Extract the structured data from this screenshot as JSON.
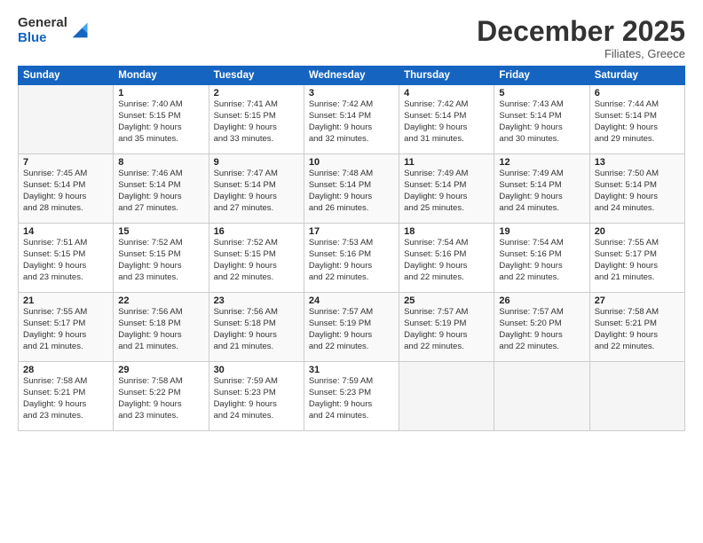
{
  "logo": {
    "general": "General",
    "blue": "Blue"
  },
  "header": {
    "month": "December 2025",
    "location": "Filiates, Greece"
  },
  "weekdays": [
    "Sunday",
    "Monday",
    "Tuesday",
    "Wednesday",
    "Thursday",
    "Friday",
    "Saturday"
  ],
  "weeks": [
    [
      {
        "day": "",
        "sunrise": "",
        "sunset": "",
        "daylight": ""
      },
      {
        "day": "1",
        "sunrise": "Sunrise: 7:40 AM",
        "sunset": "Sunset: 5:15 PM",
        "daylight": "Daylight: 9 hours and 35 minutes."
      },
      {
        "day": "2",
        "sunrise": "Sunrise: 7:41 AM",
        "sunset": "Sunset: 5:15 PM",
        "daylight": "Daylight: 9 hours and 33 minutes."
      },
      {
        "day": "3",
        "sunrise": "Sunrise: 7:42 AM",
        "sunset": "Sunset: 5:14 PM",
        "daylight": "Daylight: 9 hours and 32 minutes."
      },
      {
        "day": "4",
        "sunrise": "Sunrise: 7:42 AM",
        "sunset": "Sunset: 5:14 PM",
        "daylight": "Daylight: 9 hours and 31 minutes."
      },
      {
        "day": "5",
        "sunrise": "Sunrise: 7:43 AM",
        "sunset": "Sunset: 5:14 PM",
        "daylight": "Daylight: 9 hours and 30 minutes."
      },
      {
        "day": "6",
        "sunrise": "Sunrise: 7:44 AM",
        "sunset": "Sunset: 5:14 PM",
        "daylight": "Daylight: 9 hours and 29 minutes."
      }
    ],
    [
      {
        "day": "7",
        "sunrise": "Sunrise: 7:45 AM",
        "sunset": "Sunset: 5:14 PM",
        "daylight": "Daylight: 9 hours and 28 minutes."
      },
      {
        "day": "8",
        "sunrise": "Sunrise: 7:46 AM",
        "sunset": "Sunset: 5:14 PM",
        "daylight": "Daylight: 9 hours and 27 minutes."
      },
      {
        "day": "9",
        "sunrise": "Sunrise: 7:47 AM",
        "sunset": "Sunset: 5:14 PM",
        "daylight": "Daylight: 9 hours and 27 minutes."
      },
      {
        "day": "10",
        "sunrise": "Sunrise: 7:48 AM",
        "sunset": "Sunset: 5:14 PM",
        "daylight": "Daylight: 9 hours and 26 minutes."
      },
      {
        "day": "11",
        "sunrise": "Sunrise: 7:49 AM",
        "sunset": "Sunset: 5:14 PM",
        "daylight": "Daylight: 9 hours and 25 minutes."
      },
      {
        "day": "12",
        "sunrise": "Sunrise: 7:49 AM",
        "sunset": "Sunset: 5:14 PM",
        "daylight": "Daylight: 9 hours and 24 minutes."
      },
      {
        "day": "13",
        "sunrise": "Sunrise: 7:50 AM",
        "sunset": "Sunset: 5:14 PM",
        "daylight": "Daylight: 9 hours and 24 minutes."
      }
    ],
    [
      {
        "day": "14",
        "sunrise": "Sunrise: 7:51 AM",
        "sunset": "Sunset: 5:15 PM",
        "daylight": "Daylight: 9 hours and 23 minutes."
      },
      {
        "day": "15",
        "sunrise": "Sunrise: 7:52 AM",
        "sunset": "Sunset: 5:15 PM",
        "daylight": "Daylight: 9 hours and 23 minutes."
      },
      {
        "day": "16",
        "sunrise": "Sunrise: 7:52 AM",
        "sunset": "Sunset: 5:15 PM",
        "daylight": "Daylight: 9 hours and 22 minutes."
      },
      {
        "day": "17",
        "sunrise": "Sunrise: 7:53 AM",
        "sunset": "Sunset: 5:16 PM",
        "daylight": "Daylight: 9 hours and 22 minutes."
      },
      {
        "day": "18",
        "sunrise": "Sunrise: 7:54 AM",
        "sunset": "Sunset: 5:16 PM",
        "daylight": "Daylight: 9 hours and 22 minutes."
      },
      {
        "day": "19",
        "sunrise": "Sunrise: 7:54 AM",
        "sunset": "Sunset: 5:16 PM",
        "daylight": "Daylight: 9 hours and 22 minutes."
      },
      {
        "day": "20",
        "sunrise": "Sunrise: 7:55 AM",
        "sunset": "Sunset: 5:17 PM",
        "daylight": "Daylight: 9 hours and 21 minutes."
      }
    ],
    [
      {
        "day": "21",
        "sunrise": "Sunrise: 7:55 AM",
        "sunset": "Sunset: 5:17 PM",
        "daylight": "Daylight: 9 hours and 21 minutes."
      },
      {
        "day": "22",
        "sunrise": "Sunrise: 7:56 AM",
        "sunset": "Sunset: 5:18 PM",
        "daylight": "Daylight: 9 hours and 21 minutes."
      },
      {
        "day": "23",
        "sunrise": "Sunrise: 7:56 AM",
        "sunset": "Sunset: 5:18 PM",
        "daylight": "Daylight: 9 hours and 21 minutes."
      },
      {
        "day": "24",
        "sunrise": "Sunrise: 7:57 AM",
        "sunset": "Sunset: 5:19 PM",
        "daylight": "Daylight: 9 hours and 22 minutes."
      },
      {
        "day": "25",
        "sunrise": "Sunrise: 7:57 AM",
        "sunset": "Sunset: 5:19 PM",
        "daylight": "Daylight: 9 hours and 22 minutes."
      },
      {
        "day": "26",
        "sunrise": "Sunrise: 7:57 AM",
        "sunset": "Sunset: 5:20 PM",
        "daylight": "Daylight: 9 hours and 22 minutes."
      },
      {
        "day": "27",
        "sunrise": "Sunrise: 7:58 AM",
        "sunset": "Sunset: 5:21 PM",
        "daylight": "Daylight: 9 hours and 22 minutes."
      }
    ],
    [
      {
        "day": "28",
        "sunrise": "Sunrise: 7:58 AM",
        "sunset": "Sunset: 5:21 PM",
        "daylight": "Daylight: 9 hours and 23 minutes."
      },
      {
        "day": "29",
        "sunrise": "Sunrise: 7:58 AM",
        "sunset": "Sunset: 5:22 PM",
        "daylight": "Daylight: 9 hours and 23 minutes."
      },
      {
        "day": "30",
        "sunrise": "Sunrise: 7:59 AM",
        "sunset": "Sunset: 5:23 PM",
        "daylight": "Daylight: 9 hours and 24 minutes."
      },
      {
        "day": "31",
        "sunrise": "Sunrise: 7:59 AM",
        "sunset": "Sunset: 5:23 PM",
        "daylight": "Daylight: 9 hours and 24 minutes."
      },
      {
        "day": "",
        "sunrise": "",
        "sunset": "",
        "daylight": ""
      },
      {
        "day": "",
        "sunrise": "",
        "sunset": "",
        "daylight": ""
      },
      {
        "day": "",
        "sunrise": "",
        "sunset": "",
        "daylight": ""
      }
    ]
  ]
}
